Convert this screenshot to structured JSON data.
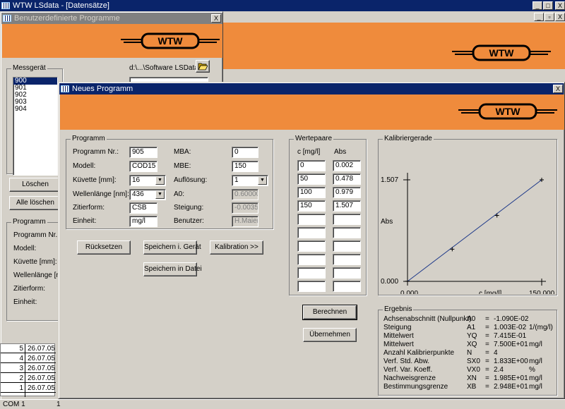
{
  "main_window": {
    "title": "WTW LSdata - [Datensätze]",
    "controls": [
      "_",
      "□",
      "X"
    ],
    "child_controls": [
      "_",
      "▫",
      "X"
    ]
  },
  "benutzer_window": {
    "title": "Benutzerdefinierte Programme",
    "close": "X",
    "messgeraet_label": "Messgerät",
    "messgeraete": [
      "900",
      "901",
      "902",
      "903",
      "904"
    ],
    "path": "d:\\...\\Software LSData",
    "loeschen": "Löschen",
    "alle_loeschen": "Alle löschen",
    "programm_group": "Programm",
    "labels": [
      "Programm Nr.:",
      "Modell:",
      "Küvette [mm]:",
      "Wellenlänge [nm]:",
      "Zitierform:",
      "Einheit:"
    ]
  },
  "datensaetze": {
    "rows": [
      {
        "nr": "5",
        "date": "26.07.05"
      },
      {
        "nr": "4",
        "date": "26.07.05"
      },
      {
        "nr": "3",
        "date": "26.07.05"
      },
      {
        "nr": "2",
        "date": "26.07.05"
      },
      {
        "nr": "1",
        "date": "26.07.05"
      }
    ]
  },
  "statusbar": {
    "port": "COM 1",
    "item2": "1"
  },
  "neues_window": {
    "title": "Neues Programm",
    "close": "X",
    "programm": {
      "group": "Programm",
      "programm_nr_label": "Programm Nr.:",
      "programm_nr": "905",
      "modell_label": "Modell:",
      "modell": "COD15",
      "kuevette_label": "Küvette [mm]:",
      "kuevette": "16",
      "wellenlaenge_label": "Wellenlänge [nm]:",
      "wellenlaenge": "436",
      "zitierform_label": "Zitierform:",
      "zitierform": "CSB",
      "einheit_label": "Einheit:",
      "einheit": "mg/l",
      "mba_label": "MBA:",
      "mba": "0",
      "mbe_label": "MBE:",
      "mbe": "150",
      "aufloesung_label": "Auflösung:",
      "aufloesung": "1",
      "a0_label": "A0:",
      "a0": "0.60000",
      "steigung_label": "Steigung:",
      "steigung": "-0.00358",
      "benutzer_label": "Benutzer:",
      "benutzer": "H.Maier"
    },
    "buttons": {
      "ruecksetzen": "Rücksetzen",
      "speichern_geraet": "Speichern i. Gerät",
      "kalibration": "Kalibration >>",
      "speichern_datei": "Speichern in Datei",
      "berechnen": "Berechnen",
      "uebernehmen": "Übernehmen"
    },
    "wertepaare": {
      "group": "Wertepaare",
      "col_c": "c [mg/l]",
      "col_abs": "Abs",
      "rows": [
        {
          "c": "0",
          "abs": "0.002"
        },
        {
          "c": "50",
          "abs": "0.478"
        },
        {
          "c": "100",
          "abs": "0.979"
        },
        {
          "c": "150",
          "abs": "1.507"
        },
        {
          "c": "",
          "abs": ""
        },
        {
          "c": "",
          "abs": ""
        },
        {
          "c": "",
          "abs": ""
        },
        {
          "c": "",
          "abs": ""
        },
        {
          "c": "",
          "abs": ""
        },
        {
          "c": "",
          "abs": ""
        }
      ]
    },
    "kalibriergerade": {
      "group": "Kalibriergerade"
    },
    "ergebnis": {
      "group": "Ergebnis",
      "rows": [
        {
          "name": "Achsenabschnitt (Nullpunkt)",
          "sym": "A0",
          "eq": "=",
          "val": "-1.090E-02",
          "unit": ""
        },
        {
          "name": "Steigung",
          "sym": "A1",
          "eq": "=",
          "val": "1.003E-02",
          "unit": "1/(mg/l)"
        },
        {
          "name": "Mittelwert",
          "sym": "YQ",
          "eq": "=",
          "val": "7.415E-01",
          "unit": ""
        },
        {
          "name": "Mittelwert",
          "sym": "XQ",
          "eq": "=",
          "val": "7.500E+01",
          "unit": "mg/l"
        },
        {
          "name": "Anzahl Kalibrierpunkte",
          "sym": "N",
          "eq": "=",
          "val": "4",
          "unit": ""
        },
        {
          "name": "Verf. Std. Abw.",
          "sym": "SX0",
          "eq": "=",
          "val": "1.833E+00",
          "unit": "mg/l"
        },
        {
          "name": "Verf. Var. Koeff.",
          "sym": "VX0",
          "eq": "=",
          "val": "2.4",
          "unit": "%"
        },
        {
          "name": "Nachweisgrenze",
          "sym": "XN",
          "eq": "=",
          "val": "1.985E+01",
          "unit": "mg/l"
        },
        {
          "name": "Bestimmungsgrenze",
          "sym": "XB",
          "eq": "=",
          "val": "2.948E+01",
          "unit": "mg/l"
        }
      ]
    }
  },
  "chart_data": {
    "type": "scatter",
    "xlabel": "c [mg/l]",
    "ylabel": "Abs",
    "xlim": [
      0,
      150
    ],
    "ylim": [
      0,
      1.507
    ],
    "x_ticks": [
      "0.000",
      "150.000"
    ],
    "y_ticks": [
      "0.000",
      "1.507"
    ],
    "points": [
      {
        "x": 0,
        "y": 0.002
      },
      {
        "x": 50,
        "y": 0.478
      },
      {
        "x": 100,
        "y": 0.979
      },
      {
        "x": 150,
        "y": 1.507
      }
    ],
    "line": {
      "x": [
        0,
        150
      ],
      "y": [
        0,
        1.507
      ],
      "color": "#1f3a8a"
    },
    "grid": false
  },
  "colors": {
    "banner": "#ef8b3c",
    "titlebar": "#0a246a",
    "list_selection": "#0a246a"
  },
  "icons": {
    "folder": "folder-open-icon",
    "app": "table-app-icon"
  }
}
